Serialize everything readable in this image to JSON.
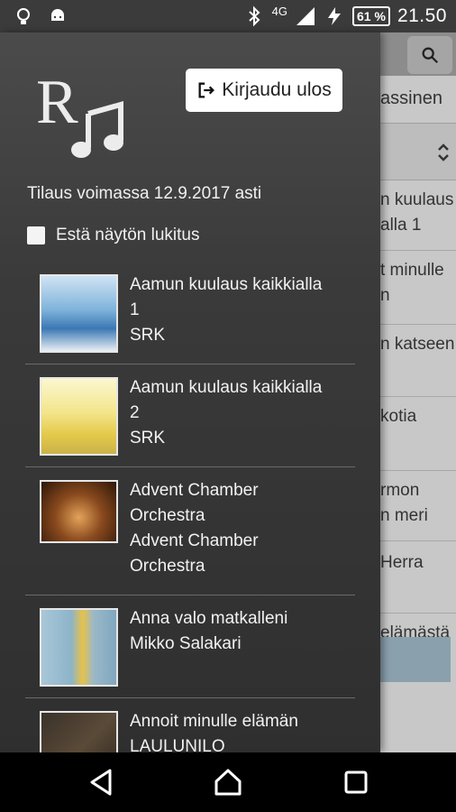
{
  "status_bar": {
    "network": "4G",
    "battery": "61 %",
    "time": "21.50",
    "icons": [
      "lightbulb-icon",
      "android-icon",
      "bluetooth-icon",
      "signal-icon",
      "charging-icon"
    ]
  },
  "background_app": {
    "tab_fragment": "assinen",
    "rows": [
      {
        "line1": "n kuulaus",
        "line2": "alla 1"
      },
      {
        "line1": "t minulle",
        "line2": "n"
      },
      {
        "line1": "n katseen",
        "line2": ""
      },
      {
        "line1": "kotia",
        "line2": ""
      },
      {
        "line1": "rmon",
        "line2": "n meri"
      },
      {
        "line1": "Herra",
        "line2": ""
      },
      {
        "line1": "elämästä",
        "line2": ""
      }
    ]
  },
  "drawer": {
    "logout_label": "Kirjaudu ulos",
    "subscription_text": "Tilaus voimassa 12.9.2017 asti",
    "lock_label": "Estä näytön lukitus",
    "lock_checked": false,
    "albums": [
      {
        "title_lines": [
          "Aamun kuulaus kaikkialla",
          "1"
        ],
        "artist_lines": [
          "SRK"
        ]
      },
      {
        "title_lines": [
          "Aamun kuulaus kaikkialla",
          "2"
        ],
        "artist_lines": [
          "SRK"
        ]
      },
      {
        "title_lines": [
          "Advent Chamber",
          "Orchestra"
        ],
        "artist_lines": [
          "Advent Chamber",
          "Orchestra"
        ]
      },
      {
        "title_lines": [
          "Anna valo matkalleni"
        ],
        "artist_lines": [
          "Mikko Salakari"
        ]
      },
      {
        "title_lines": [
          "Annoit minulle elämän"
        ],
        "artist_lines": [
          "LAULUNILO"
        ]
      }
    ]
  },
  "colors": {
    "drawer_bg": "#3a3a3a",
    "status_bar": "#3b3b3b",
    "text": "#f2f2f2",
    "button_bg": "#ffffff"
  }
}
